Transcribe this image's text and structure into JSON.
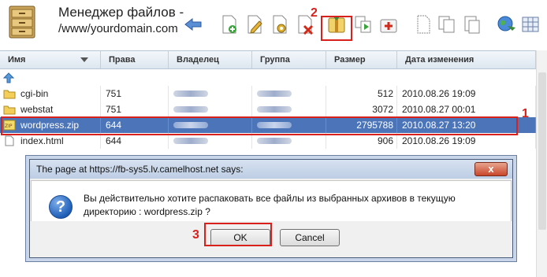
{
  "header": {
    "title_line1": "Менеджер файлов -",
    "title_line2": "/www/yourdomain.com"
  },
  "annotations": {
    "step1": "1",
    "step2": "2",
    "step3": "3"
  },
  "columns": {
    "name": "Имя",
    "perms": "Права",
    "owner": "Владелец",
    "group": "Группа",
    "size": "Размер",
    "modified": "Дата изменения"
  },
  "files": [
    {
      "name": "cgi-bin",
      "perms": "751",
      "size": "512",
      "modified": "2010.08.26 19:09",
      "type": "folder"
    },
    {
      "name": "webstat",
      "perms": "751",
      "size": "3072",
      "modified": "2010.08.27 00:01",
      "type": "folder"
    },
    {
      "name": "wordpress.zip",
      "perms": "644",
      "size": "2795788",
      "modified": "2010.08.27 13:20",
      "type": "zip",
      "selected": true
    },
    {
      "name": "index.html",
      "perms": "644",
      "size": "906",
      "modified": "2010.08.26 19:09",
      "type": "file"
    }
  ],
  "dialog": {
    "title": "The page at https://fb-sys5.lv.camelhost.net says:",
    "close_label": "x",
    "message": "Вы действительно хотите распаковать все файлы из выбранных архивов в текущую директорию :  wordpress.zip ?",
    "ok_label": "OK",
    "cancel_label": "Cancel"
  },
  "colors": {
    "selection": "#4b74b9",
    "highlight": "#d8201c"
  }
}
